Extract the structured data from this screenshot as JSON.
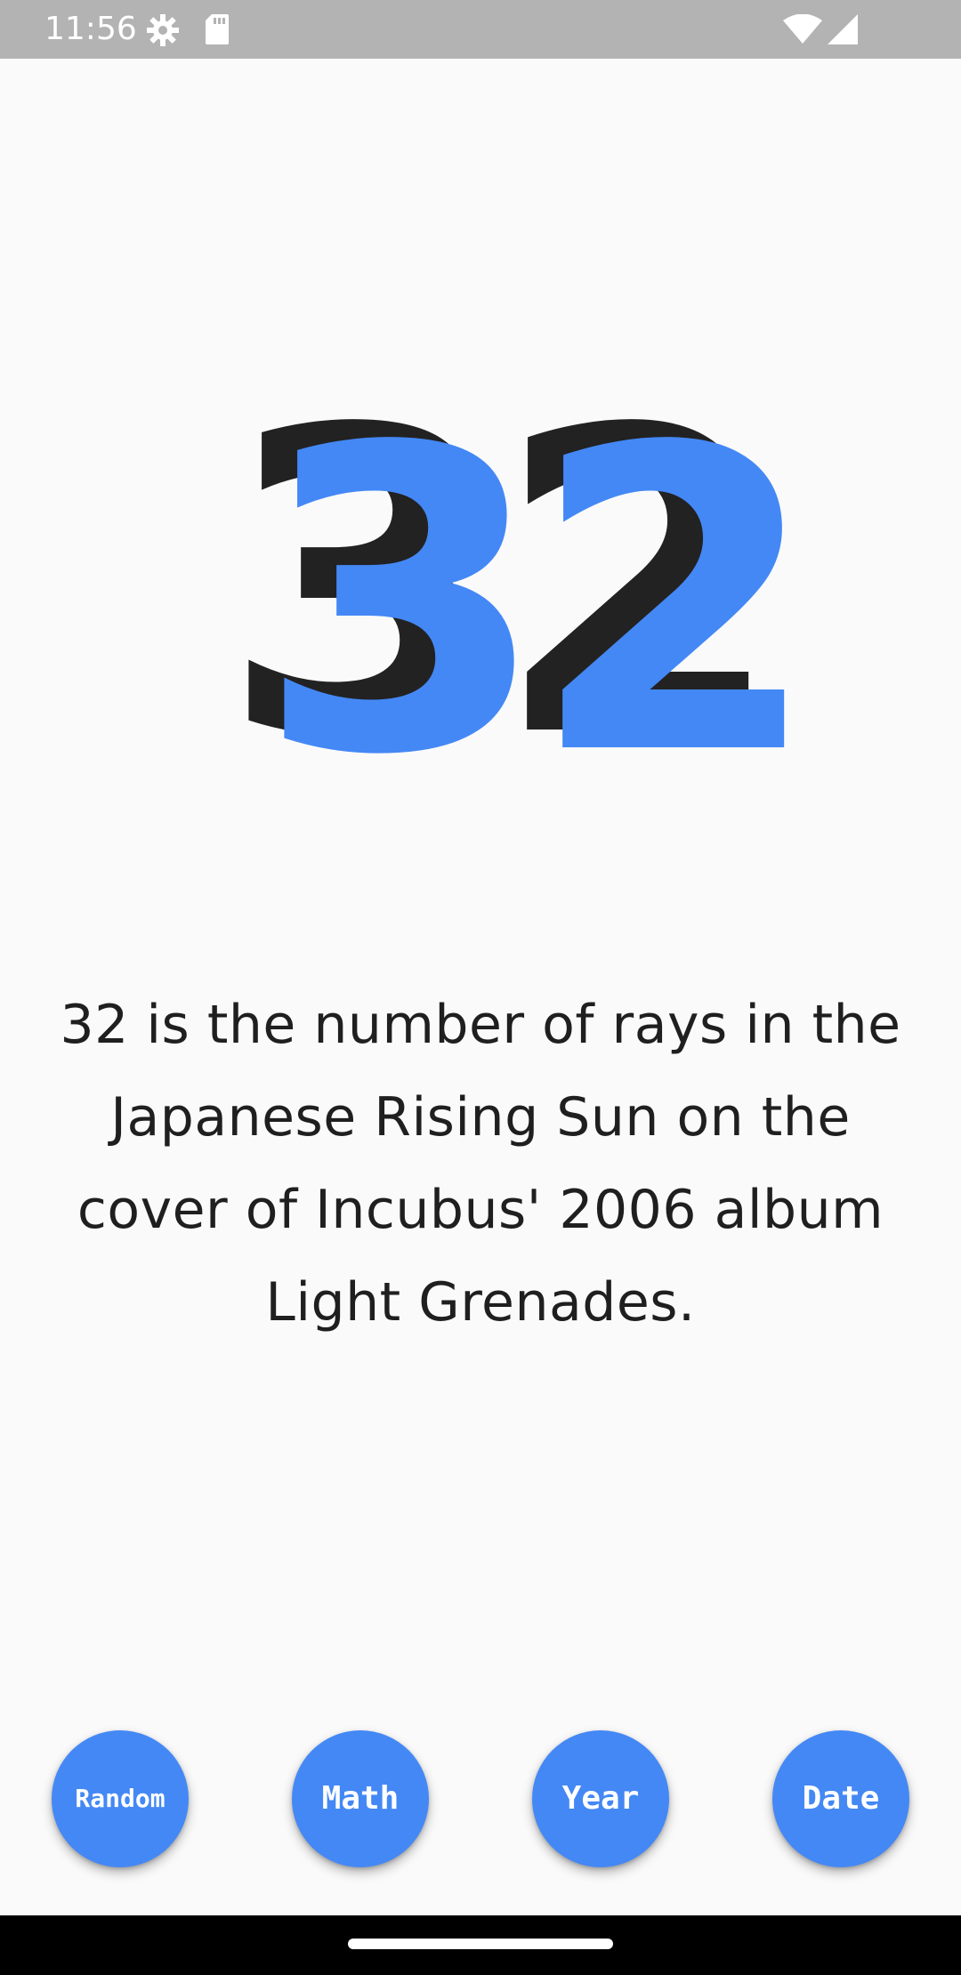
{
  "status_bar": {
    "time": "11:56",
    "icons": [
      "settings-icon",
      "sd-card-icon",
      "wifi-icon",
      "cell-signal-icon"
    ],
    "background": "#b3b3b3"
  },
  "main": {
    "number": "32",
    "number_shadow_color": "#222222",
    "number_color": "#4488f5",
    "fact": "32 is the number of rays in the Japanese Rising Sun on the cover of Incubus' 2006 album Light Grenades."
  },
  "buttons": {
    "random": "Random",
    "math": "Math",
    "year": "Year",
    "date": "Date",
    "color": "#4488f5"
  },
  "colors": {
    "background": "#fafafa",
    "text": "#1f1f1f"
  }
}
